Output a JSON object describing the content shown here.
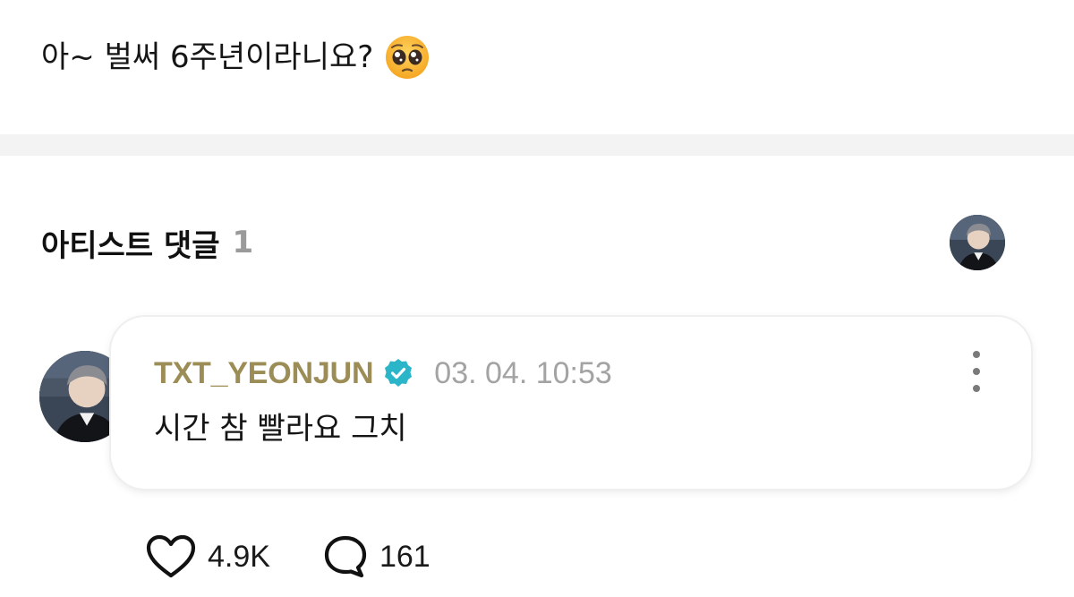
{
  "post": {
    "text": "아~ 벌써 6주년이라니요?",
    "emoji": "pleading-face"
  },
  "artist_comments": {
    "title": "아티스트 댓글",
    "count": "1"
  },
  "comment": {
    "author": "TXT_YEONJUN",
    "verified": true,
    "timestamp": "03. 04. 10:53",
    "body": "시간 참 빨라요 그치"
  },
  "reactions": {
    "likes": "4.9K",
    "replies": "161"
  },
  "colors": {
    "author_gold": "#9c8d56",
    "verified_teal": "#2bb5c8",
    "muted_gray": "#a3a3a3",
    "divider": "#f3f3f3"
  },
  "icons": {
    "like": "heart-icon",
    "reply": "speech-bubble-icon",
    "menu": "more-vertical-icon",
    "badge": "verified-badge-icon"
  }
}
